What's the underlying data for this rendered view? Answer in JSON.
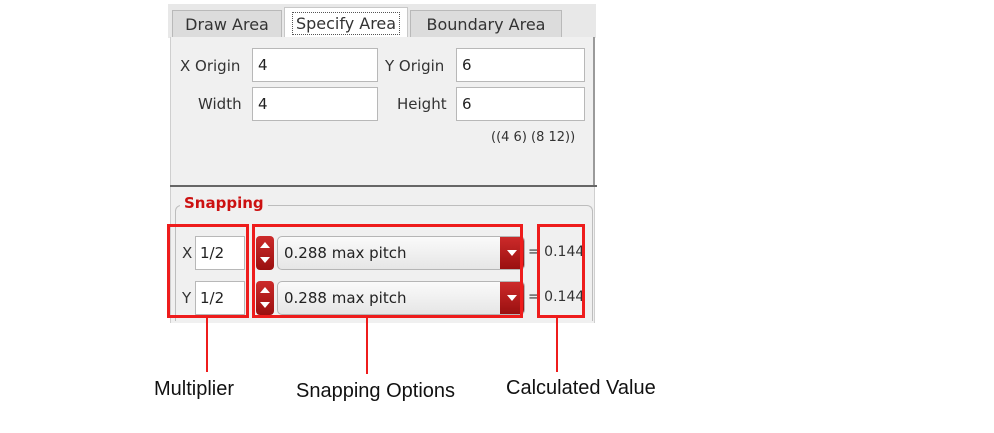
{
  "tabs": [
    {
      "label": "Draw Area",
      "active": false
    },
    {
      "label": "Specify Area",
      "active": true
    },
    {
      "label": "Boundary Area",
      "active": false
    }
  ],
  "area": {
    "x_origin_label": "X Origin",
    "x_origin_value": "4",
    "y_origin_label": "Y Origin",
    "y_origin_value": "6",
    "width_label": "Width",
    "width_value": "4",
    "height_label": "Height",
    "height_value": "6",
    "bbox_text": "((4 6) (8 12))"
  },
  "snapping": {
    "title": "Snapping",
    "rows": [
      {
        "axis": "X",
        "multiplier": "1/2",
        "option": "0.288 max pitch",
        "calculated": "= 0.144"
      },
      {
        "axis": "Y",
        "multiplier": "1/2",
        "option": "0.288 max pitch",
        "calculated": "= 0.144"
      }
    ]
  },
  "annotations": {
    "multiplier": "Multiplier",
    "snapping_options": "Snapping Options",
    "calculated_value": "Calculated Value"
  },
  "colors": {
    "highlight": "#ee1c1c",
    "legend_text": "#cc1111",
    "control_red": "#b31b1b"
  },
  "icons": [
    "spin-up-icon",
    "spin-down-icon",
    "dropdown-arrow-icon"
  ]
}
